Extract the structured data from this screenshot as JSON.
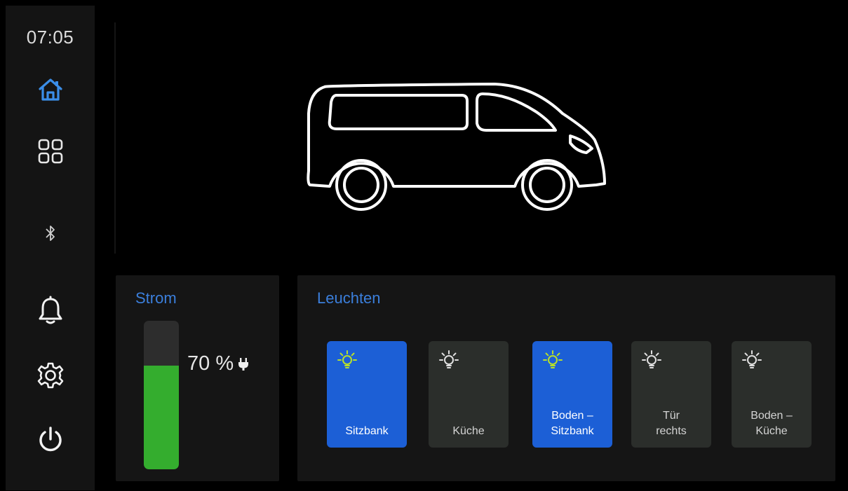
{
  "status": {
    "time": "07:05"
  },
  "sidebar": {
    "accent_color": "#3b8ee8",
    "items": [
      {
        "id": "home",
        "icon": "home-icon",
        "active": true
      },
      {
        "id": "apps",
        "icon": "grid-icon",
        "active": false
      },
      {
        "id": "bluetooth",
        "icon": "bluetooth-icon",
        "active": false
      },
      {
        "id": "notifications",
        "icon": "bell-icon",
        "active": false
      },
      {
        "id": "settings",
        "icon": "gear-icon",
        "active": false
      },
      {
        "id": "power",
        "icon": "power-icon",
        "active": false
      }
    ]
  },
  "hero": {
    "icon": "van-icon"
  },
  "strom": {
    "title": "Strom",
    "percent_text": "70 %",
    "level_percent": 70,
    "fill_color": "#34ad2e",
    "charging_icon": "plug-icon"
  },
  "leuchten": {
    "title": "Leuchten",
    "on_color": "#1c5fd6",
    "off_color": "#2b2e2b",
    "bulb_on_color": "#b8e02a",
    "bulb_off_color": "#e0e0e0",
    "lights": [
      {
        "label": "Sitzbank",
        "on": true
      },
      {
        "label": "Küche",
        "on": false
      },
      {
        "label": "Boden –\nSitzbank",
        "on": true
      },
      {
        "label": "Tür\nrechts",
        "on": false
      },
      {
        "label": "Boden –\nKüche",
        "on": false
      }
    ]
  }
}
